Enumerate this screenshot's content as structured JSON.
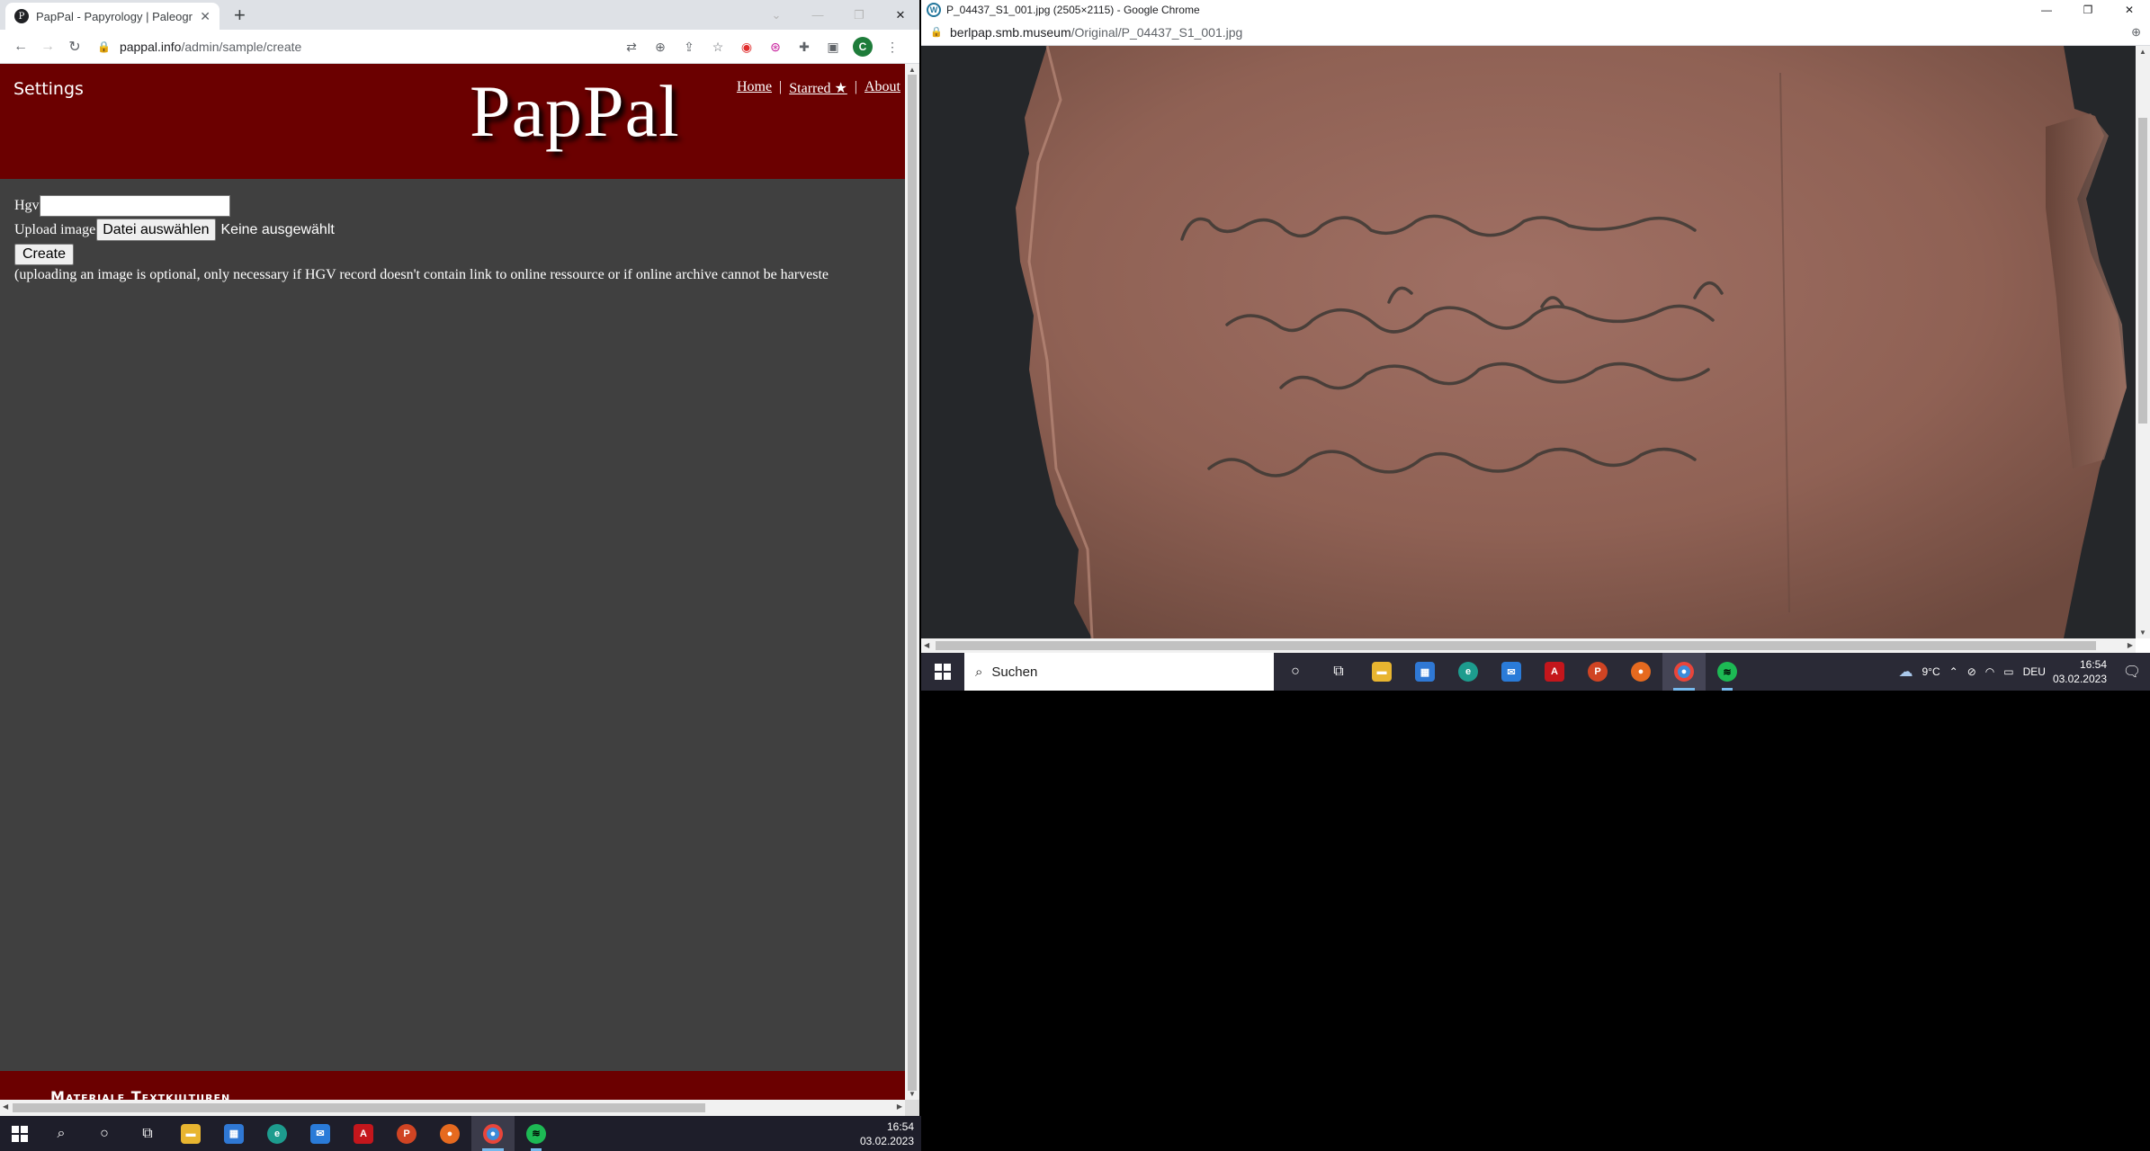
{
  "left_browser": {
    "tab_title": "PapPal - Papyrology | Paleography",
    "url_host": "pappal.info",
    "url_path": "/admin/sample/create",
    "avatar_letter": "C"
  },
  "site": {
    "settings_label": "Settings",
    "logo_text": "PapPal",
    "nav": {
      "home": "Home",
      "starred": "Starred ★",
      "about": "About",
      "sep": "|"
    },
    "form": {
      "hgv_label": "Hgv",
      "hgv_value": "",
      "upload_label": "Upload image",
      "file_button": "Datei auswählen",
      "file_status": "Keine ausgewählt",
      "create_button": "Create",
      "note": "(uploading an image is optional, only necessary if HGV record doesn't contain link to online ressource or if online archive cannot be harveste"
    },
    "footer_text": "Materiale Textkulturen"
  },
  "right_browser": {
    "window_title": "P_04437_S1_001.jpg (2505×2115) - Google Chrome",
    "url_host": "berlpap.smb.museum",
    "url_path": "/Original/P_04437_S1_001.jpg"
  },
  "taskbar_left": {
    "time": "16:54",
    "date": "03.02.2023"
  },
  "taskbar_right": {
    "search_placeholder": "Suchen",
    "weather": "9°C",
    "lang": "DEU",
    "time": "16:54",
    "date": "03.02.2023"
  }
}
